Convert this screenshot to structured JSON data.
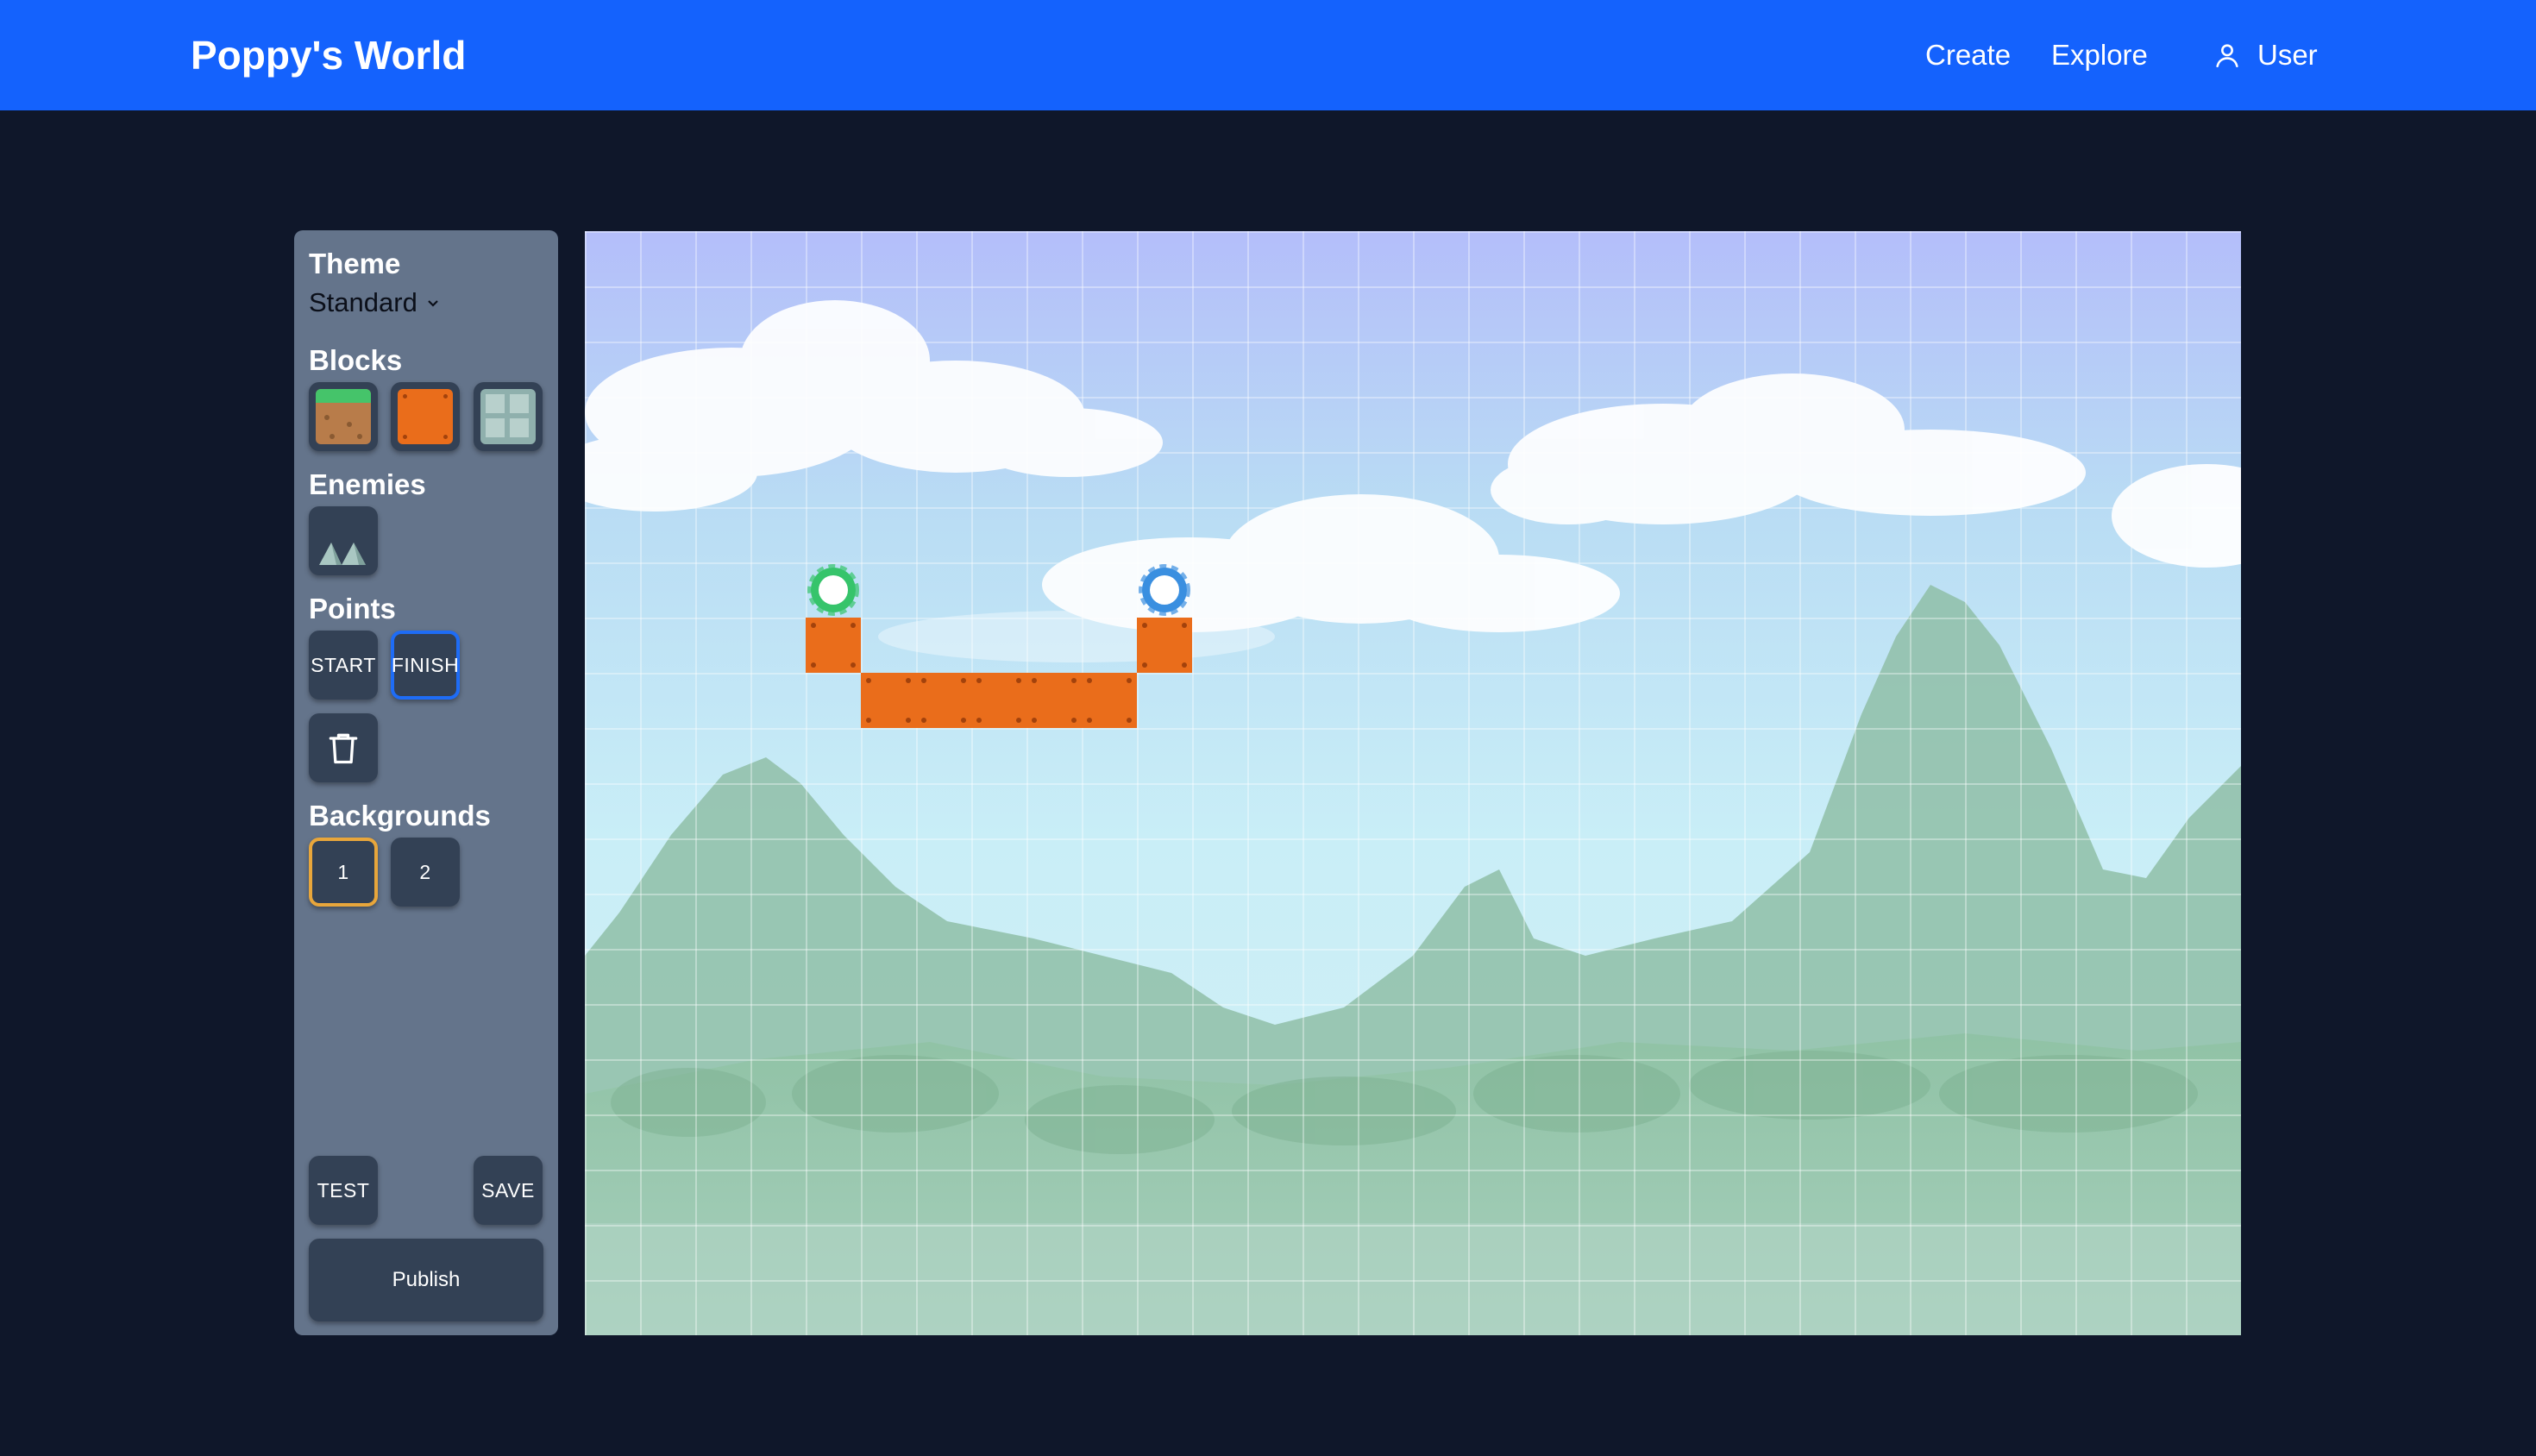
{
  "header": {
    "brand": "Poppy's World",
    "nav": {
      "create": "Create",
      "explore": "Explore",
      "user": "User"
    }
  },
  "sidebar": {
    "theme": {
      "title": "Theme",
      "value": "Standard"
    },
    "blocks": {
      "title": "Blocks",
      "items": [
        "grass-block",
        "orange-block",
        "stone-block"
      ]
    },
    "enemies": {
      "title": "Enemies",
      "items": [
        "spikes"
      ]
    },
    "points": {
      "title": "Points",
      "start": "START",
      "finish": "FINISH",
      "selected": "FINISH"
    },
    "backgrounds": {
      "title": "Backgrounds",
      "options": [
        "1",
        "2"
      ],
      "selected": "1"
    },
    "actions": {
      "test": "TEST",
      "save": "SAVE",
      "publish": "Publish"
    }
  },
  "level": {
    "colors": {
      "accent": "#1462fd",
      "block": "#ea6d1b",
      "start": "#36c46b",
      "finish": "#3a8fe0",
      "selected_tool": "#1e6cf6",
      "selected_bg": "#e8a63b"
    },
    "blocks": [
      [
        4,
        7
      ],
      [
        5,
        8
      ],
      [
        6,
        8
      ],
      [
        7,
        8
      ],
      [
        8,
        8
      ],
      [
        9,
        8
      ],
      [
        10,
        7
      ]
    ],
    "start": [
      4,
      6
    ],
    "finish": [
      10,
      6
    ]
  }
}
